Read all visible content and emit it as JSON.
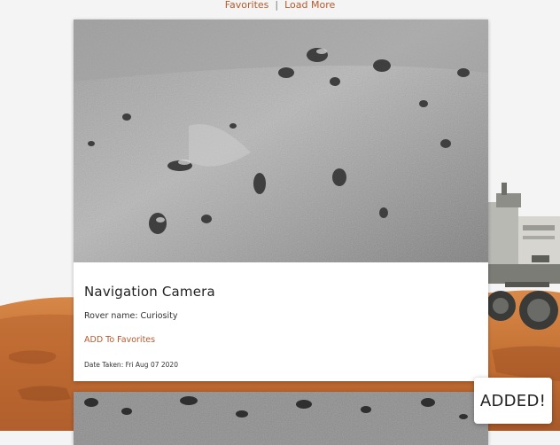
{
  "nav": {
    "favorites_label": "Favorites",
    "separator": "|",
    "load_more_label": "Load More"
  },
  "photo_card": {
    "camera_name": "Navigation Camera",
    "rover_name": "Rover name: Curiosity",
    "add_favorites_label": "ADD To Favorites",
    "date_taken": "Date Taken: Fri Aug 07 2020"
  },
  "toast": {
    "message": "ADDED!"
  },
  "colors": {
    "accent": "#b55a2c",
    "page_background": "#f4f4f4",
    "mars_ground": "#c9773d"
  }
}
